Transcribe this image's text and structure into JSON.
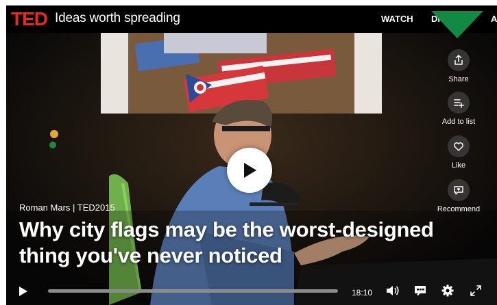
{
  "header": {
    "logo_text": "TED",
    "tagline": "Ideas worth spreading",
    "nav": {
      "watch": "WATCH",
      "discover": "DISCOVER",
      "about": "ABOUT"
    }
  },
  "actions": {
    "share": "Share",
    "add_to_list": "Add to list",
    "like": "Like",
    "recommend": "Recommend"
  },
  "talk": {
    "speaker_line": "Roman Mars | TED2015",
    "title": "Why city flags may be the worst-designed thing you've never noticed"
  },
  "player": {
    "duration": "18:10"
  },
  "colors": {
    "ted_red": "#e62b1e",
    "corner_green": "#138a43"
  }
}
